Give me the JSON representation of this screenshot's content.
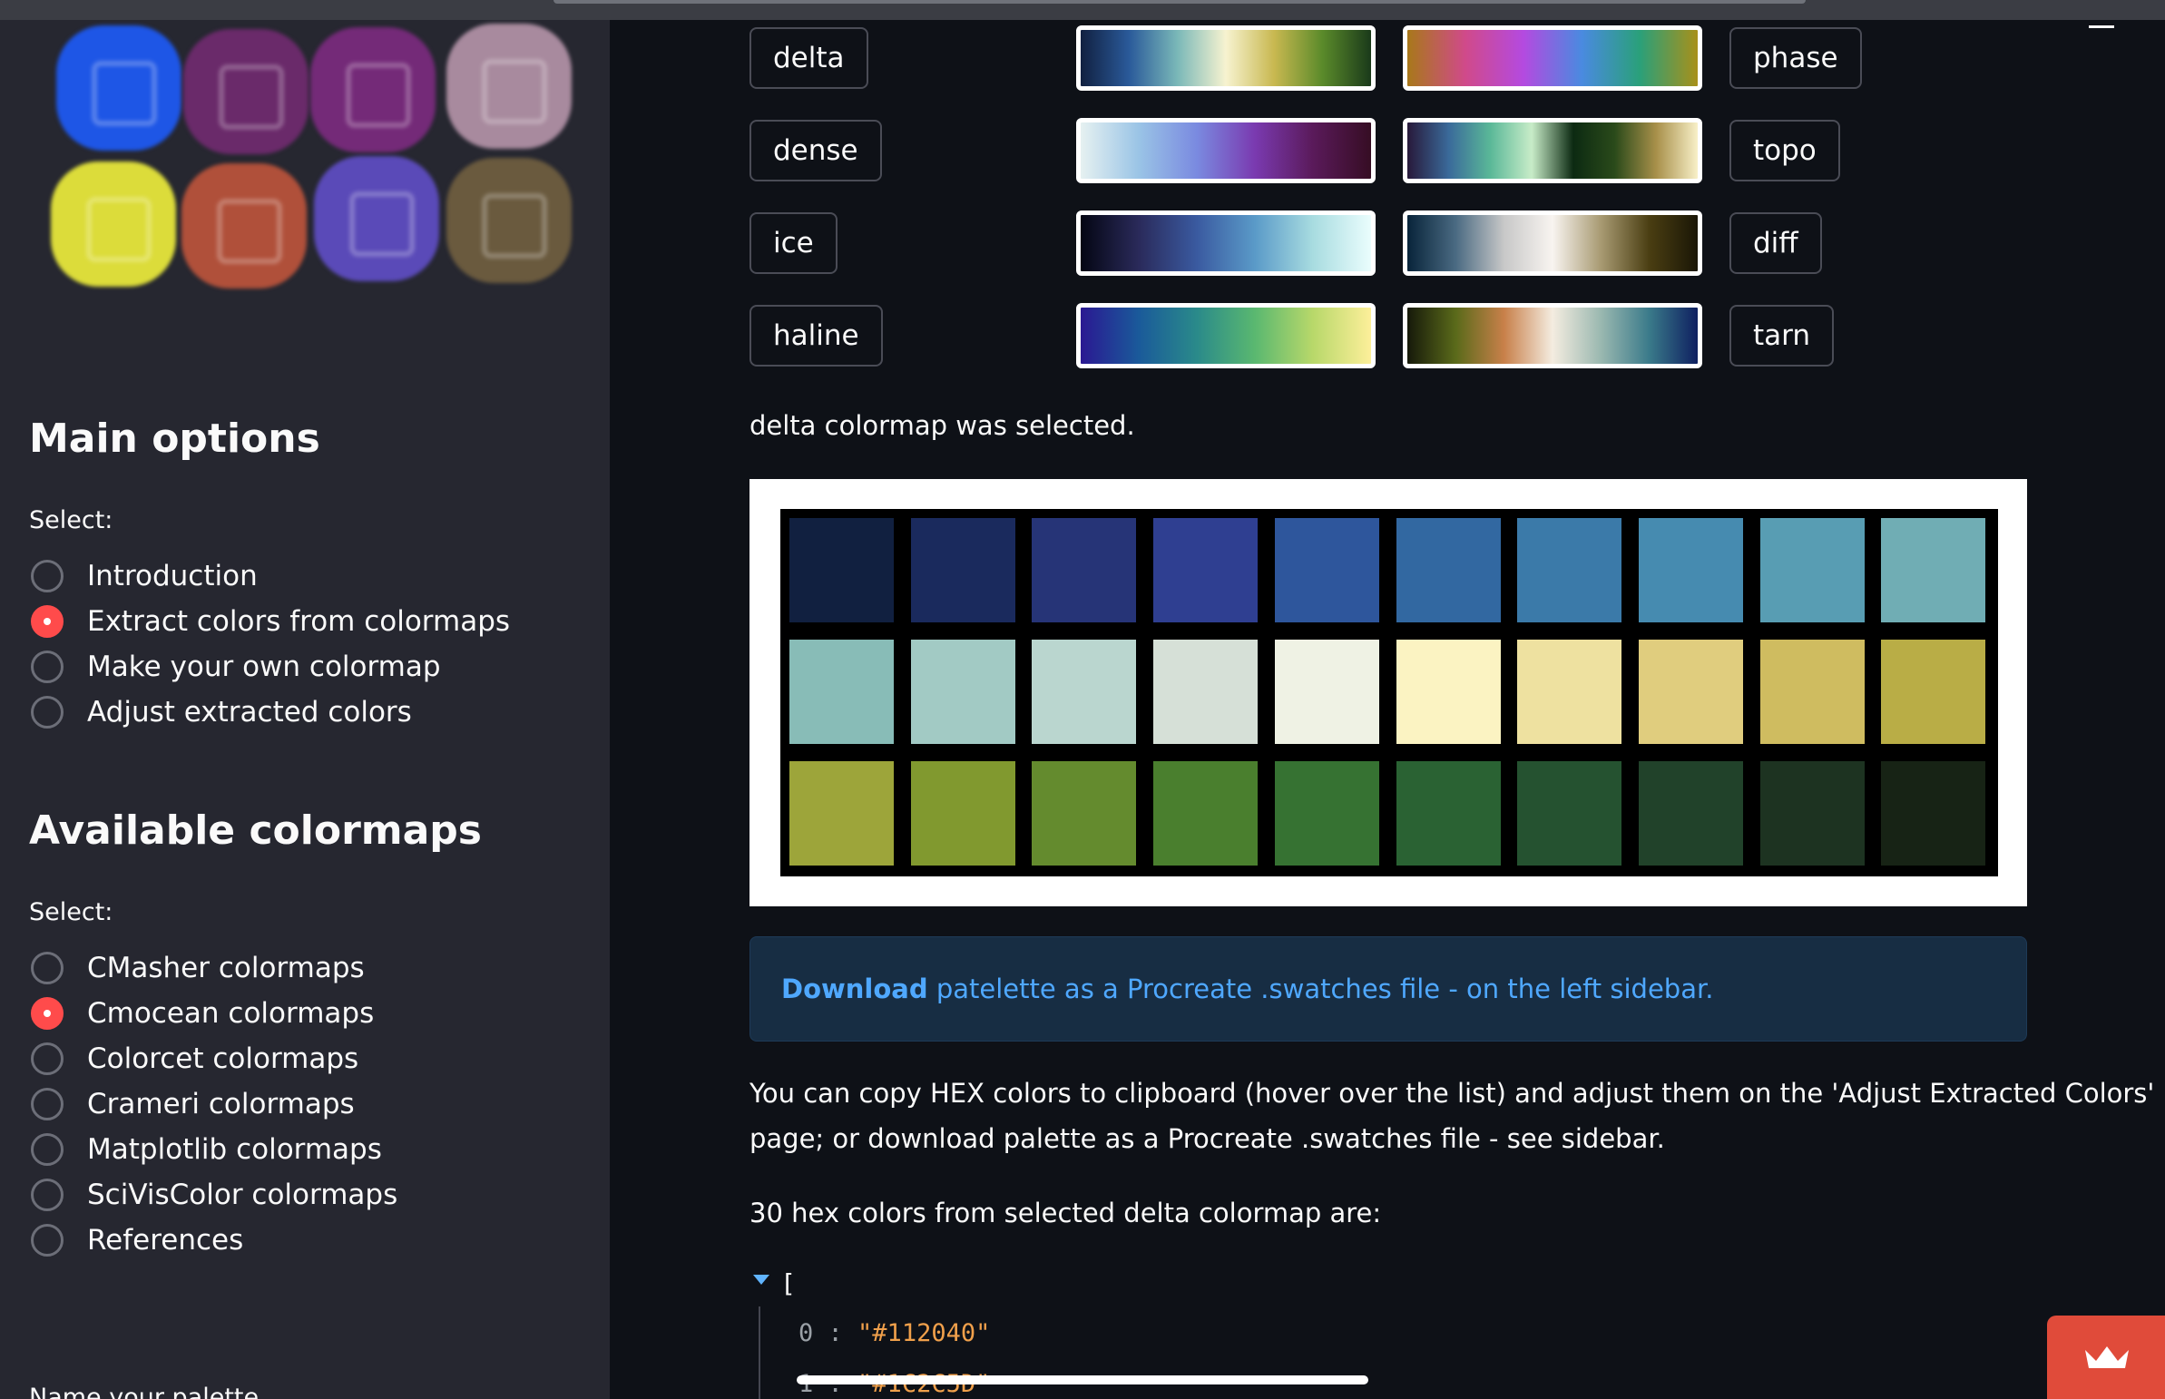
{
  "sidebar": {
    "main_options": {
      "heading": "Main options",
      "select_label": "Select:",
      "items": [
        {
          "label": "Introduction",
          "selected": false
        },
        {
          "label": "Extract colors from colormaps",
          "selected": true
        },
        {
          "label": "Make your own colormap",
          "selected": false
        },
        {
          "label": "Adjust extracted colors",
          "selected": false
        }
      ]
    },
    "available_colormaps": {
      "heading": "Available colormaps",
      "select_label": "Select:",
      "items": [
        {
          "label": "CMasher colormaps",
          "selected": false
        },
        {
          "label": "Cmocean colormaps",
          "selected": true
        },
        {
          "label": "Colorcet colormaps",
          "selected": false
        },
        {
          "label": "Crameri colormaps",
          "selected": false
        },
        {
          "label": "Matplotlib colormaps",
          "selected": false
        },
        {
          "label": "SciVisColor colormaps",
          "selected": false
        },
        {
          "label": "References",
          "selected": false
        }
      ]
    },
    "bottom_label": "Name your palette"
  },
  "colormap_rows": [
    {
      "left": {
        "name": "delta",
        "gradient": [
          "#112040",
          "#2a5a9a",
          "#7ab8b8",
          "#f7f3d0",
          "#c8b850",
          "#5a8a2a",
          "#1a3a1a"
        ]
      },
      "right": {
        "name": "phase",
        "gradient": [
          "#a8781a",
          "#d04a8a",
          "#b44ae0",
          "#4a8ae0",
          "#2aa07a",
          "#a8901a"
        ]
      }
    },
    {
      "left": {
        "name": "dense",
        "gradient": [
          "#e6f1f1",
          "#9ac4e6",
          "#7a8ae0",
          "#7a3ab0",
          "#5a1a5a",
          "#360d24"
        ]
      },
      "right": {
        "name": "topo",
        "gradient": [
          "#28193a",
          "#3a6a9a",
          "#5ab898",
          "#c8ecc8",
          "#0c2a12",
          "#2a4a1a",
          "#a8904a",
          "#f8f0c8"
        ]
      }
    },
    {
      "left": {
        "name": "ice",
        "gradient": [
          "#040613",
          "#2a2a5a",
          "#3a5aa0",
          "#5a9ac8",
          "#a8dce0",
          "#eafdfd"
        ]
      },
      "right": {
        "name": "diff",
        "gradient": [
          "#08243a",
          "#4a6a82",
          "#c8c8c8",
          "#f8f4f0",
          "#a89a72",
          "#4a3e12",
          "#1a1606"
        ]
      }
    },
    {
      "left": {
        "name": "haline",
        "gradient": [
          "#2a1892",
          "#1a5a9a",
          "#2a8a8a",
          "#5ab870",
          "#b8d86a",
          "#fdef9a"
        ]
      },
      "right": {
        "name": "tarn",
        "gradient": [
          "#16190a",
          "#5a6a1a",
          "#c8804a",
          "#f4ece0",
          "#9ab8b0",
          "#3a7a8a",
          "#0e1f60"
        ]
      }
    }
  ],
  "selected_message": "delta colormap was selected.",
  "swatches": [
    "#112040",
    "#1a2a5d",
    "#263477",
    "#2f3f91",
    "#2e569c",
    "#3268a1",
    "#3b7aa9",
    "#468bb0",
    "#589db3",
    "#70adb4",
    "#88bcb7",
    "#a2cac4",
    "#bad6cf",
    "#d6e0d7",
    "#eff2e4",
    "#fbf3c2",
    "#eee1a0",
    "#e0cd7e",
    "#cfbc60",
    "#b9ad46",
    "#9da53a",
    "#81992f",
    "#648b2e",
    "#4a7f2e",
    "#367232",
    "#2a6233",
    "#255230",
    "#21422a",
    "#1d3321",
    "#172315"
  ],
  "info_box": {
    "link_bold": "Download",
    "link_rest": " patelette as a Procreate .swatches file - on the left sidebar."
  },
  "copy_text_line1": "You can copy HEX colors to clipboard (hover over the list) and adjust them on the 'Adjust Extracted Colors'",
  "copy_text_line2": "page; or download palette as a Procreate .swatches file - see sidebar.",
  "hex_heading": "30 hex colors from selected delta colormap are:",
  "json_view": {
    "open_bracket": "[",
    "rows": [
      {
        "key": "0",
        "value": "\"#112040\""
      },
      {
        "key": "1",
        "value": "\"#1C2C5D\""
      }
    ]
  }
}
